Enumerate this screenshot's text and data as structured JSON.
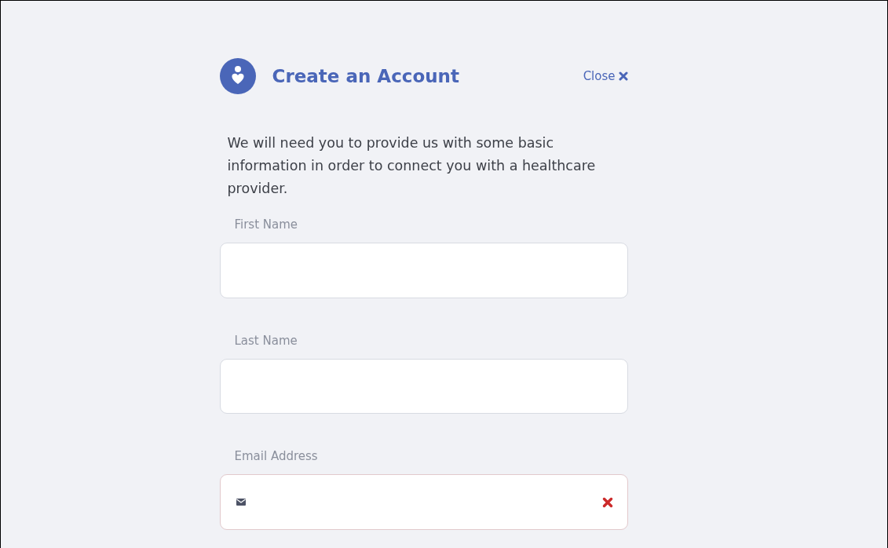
{
  "header": {
    "title": "Create an Account",
    "close_label": "Close"
  },
  "intro": "We will need you to provide us with some basic information in order to connect you with a healthcare provider.",
  "fields": [
    {
      "label": "First Name",
      "kind": "text",
      "invalid": false
    },
    {
      "label": "Last Name",
      "kind": "text",
      "invalid": false
    },
    {
      "label": "Email Address",
      "kind": "email",
      "invalid": true
    }
  ]
}
